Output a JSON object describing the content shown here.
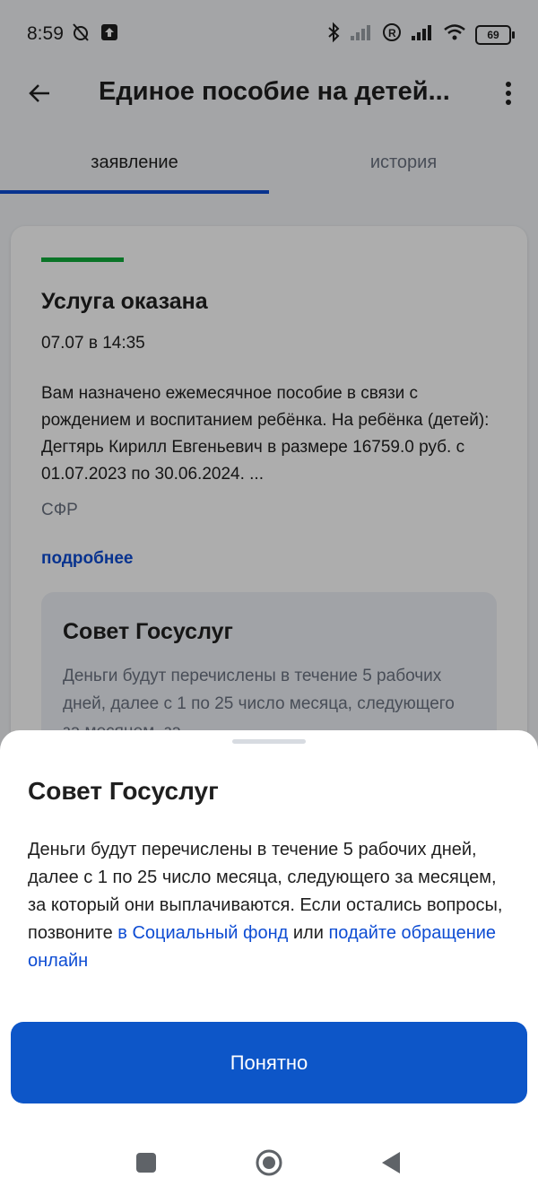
{
  "status_bar": {
    "time": "8:59",
    "battery": "69"
  },
  "app_bar": {
    "title": "Единое пособие на детей..."
  },
  "tabs": [
    {
      "label": "заявление",
      "active": true
    },
    {
      "label": "история",
      "active": false
    }
  ],
  "card": {
    "title": "Услуга оказана",
    "date": "07.07 в 14:35",
    "text": "Вам назначено ежемесячное пособие в связи с рождением и воспитанием ребёнка. На ребёнка (детей): Дегтярь Кирилл Евгеньевич в размере 16759.0 руб. с 01.07.2023 по 30.06.2024. ...",
    "source": "СФР",
    "more_link": "подробнее",
    "advice": {
      "title": "Совет Госуслуг",
      "text": "Деньги будут перечислены в течение 5 рабочих дней, далее с 1 по 25 число месяца, следующего за месяцем, за"
    }
  },
  "sheet": {
    "title": "Совет Госуслуг",
    "text_part1": "Деньги будут перечислены в течение 5 рабочих дней, далее с 1 по 25 число месяца, следующего за месяцем, за который они выплачиваются. Если остались вопросы, позвоните ",
    "link1": "в Социальный фонд",
    "text_part2": " или ",
    "link2": "подайте обращение онлайн",
    "button_label": "Понятно"
  },
  "colors": {
    "accent": "#0d4cd3",
    "button": "#0d56c8",
    "success": "#0fab3a"
  }
}
